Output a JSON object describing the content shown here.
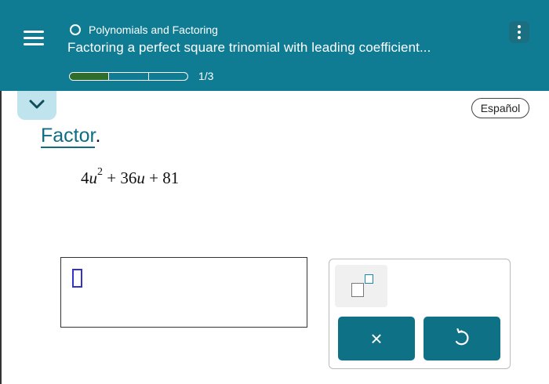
{
  "header": {
    "topic": "Polynomials and Factoring",
    "lesson_title": "Factoring a perfect square trinomial with leading coefficient...",
    "progress_text": "1/3",
    "progress": 0.3333,
    "icons": {
      "menu": "hamburger-menu-icon",
      "topic_status": "circle-icon",
      "more": "vertical-dots-icon"
    }
  },
  "nav": {
    "collapse_icon": "chevron-down-icon",
    "language_button": "Español"
  },
  "problem": {
    "instruction_word": "Factor",
    "instruction_end": ".",
    "expression": {
      "c1": "4",
      "var1": "u",
      "exp": "2",
      "plus1": " + ",
      "c2": "36",
      "var2": "u",
      "plus2": " + ",
      "c3": "81"
    }
  },
  "answer": {
    "value": ""
  },
  "tools": {
    "exponent_icon": "superscript-box-icon",
    "clear_label": "×",
    "undo_icon": "undo-arrow-icon"
  },
  "colors": {
    "header_bg": "#0f7c93",
    "accent": "#0e6d84",
    "progress_fill": "#2f6e2a",
    "button_bg": "#0f7186"
  }
}
